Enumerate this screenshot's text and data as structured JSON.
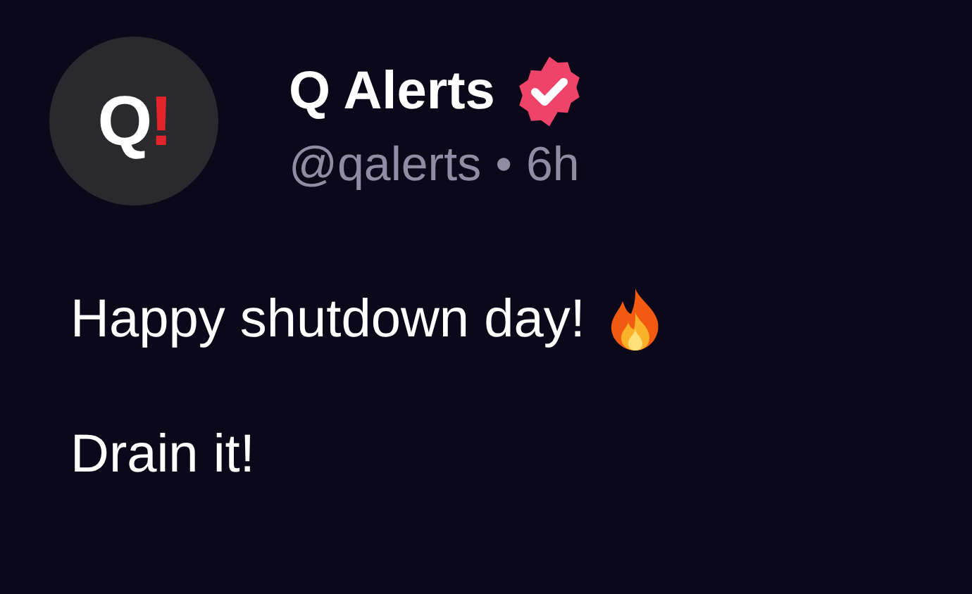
{
  "author": {
    "avatar_letters": [
      {
        "text": "Q",
        "color": "#ffffff"
      },
      {
        "text": "!",
        "color": "#e3242b"
      }
    ],
    "name": "Q Alerts",
    "verified": true,
    "handle": "@qalerts",
    "separator": "•",
    "time": "6h"
  },
  "body": [
    {
      "kind": "with_icon",
      "text": "Happy shutdown day!"
    },
    {
      "kind": "plain",
      "text": "Drain it!"
    }
  ]
}
